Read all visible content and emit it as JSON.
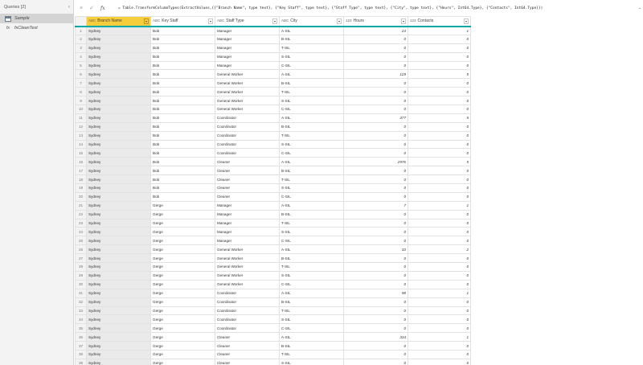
{
  "queries": {
    "header": "Queries [2]",
    "items": [
      {
        "label": "Sample",
        "icon": "table-icon",
        "selected": true
      },
      {
        "label": "fxCleanText",
        "icon": "function-icon",
        "selected": false
      }
    ]
  },
  "formula_bar": {
    "cancel": "×",
    "commit": "✓",
    "fx": "fx",
    "formula": "= Table.TransformColumnTypes(ExtractValues,{{\"Branch Name\", type text}, {\"Key Staff\", type text}, {\"Staff Type\", type text}, {\"City\", type text}, {\"Hours\", Int64.Type}, {\"Contacts\", Int64.Type}})",
    "expand": "⌄"
  },
  "columns": [
    {
      "label": "Branch Name",
      "type": "ABC"
    },
    {
      "label": "Key Staff",
      "type": "ABC"
    },
    {
      "label": "Staff Type",
      "type": "ABC"
    },
    {
      "label": "City",
      "type": "ABC"
    },
    {
      "label": "Hours",
      "type": "123"
    },
    {
      "label": "Contacts",
      "type": "123"
    }
  ],
  "rows": [
    [
      "Sydney",
      "Bob",
      "Manager",
      "A-SIL",
      "24",
      "1"
    ],
    [
      "Sydney",
      "Bob",
      "Manager",
      "B-SIL",
      "0",
      "0"
    ],
    [
      "Sydney",
      "Bob",
      "Manager",
      "T-SIL",
      "0",
      "0"
    ],
    [
      "Sydney",
      "Bob",
      "Manager",
      "S-SIL",
      "0",
      "0"
    ],
    [
      "Sydney",
      "Bob",
      "Manager",
      "C-SIL",
      "0",
      "0"
    ],
    [
      "Sydney",
      "Bob",
      "General Worker",
      "A-SIL",
      "129",
      "5"
    ],
    [
      "Sydney",
      "Bob",
      "General Worker",
      "B-SIL",
      "0",
      "0"
    ],
    [
      "Sydney",
      "Bob",
      "General Worker",
      "T-SIL",
      "0",
      "0"
    ],
    [
      "Sydney",
      "Bob",
      "General Worker",
      "S-SIL",
      "0",
      "0"
    ],
    [
      "Sydney",
      "Bob",
      "General Worker",
      "C-SIL",
      "0",
      "0"
    ],
    [
      "Sydney",
      "Bob",
      "Coordinator",
      "A-SIL",
      "477",
      "5"
    ],
    [
      "Sydney",
      "Bob",
      "Coordinator",
      "B-SIL",
      "0",
      "0"
    ],
    [
      "Sydney",
      "Bob",
      "Coordinator",
      "T-SIL",
      "0",
      "0"
    ],
    [
      "Sydney",
      "Bob",
      "Coordinator",
      "S-SIL",
      "0",
      "0"
    ],
    [
      "Sydney",
      "Bob",
      "Coordinator",
      "C-SIL",
      "0",
      "0"
    ],
    [
      "Sydney",
      "Bob",
      "Cleaner",
      "A-SIL",
      "2976",
      "5"
    ],
    [
      "Sydney",
      "Bob",
      "Cleaner",
      "B-SIL",
      "0",
      "0"
    ],
    [
      "Sydney",
      "Bob",
      "Cleaner",
      "T-SIL",
      "0",
      "0"
    ],
    [
      "Sydney",
      "Bob",
      "Cleaner",
      "S-SIL",
      "0",
      "0"
    ],
    [
      "Sydney",
      "Bob",
      "Cleaner",
      "C-SIL",
      "0",
      "0"
    ],
    [
      "Sydney",
      "Gerge",
      "Manager",
      "A-SIL",
      "7",
      "1"
    ],
    [
      "Sydney",
      "Gerge",
      "Manager",
      "B-SIL",
      "0",
      "0"
    ],
    [
      "Sydney",
      "Gerge",
      "Manager",
      "T-SIL",
      "0",
      "0"
    ],
    [
      "Sydney",
      "Gerge",
      "Manager",
      "S-SIL",
      "0",
      "0"
    ],
    [
      "Sydney",
      "Gerge",
      "Manager",
      "C-SIL",
      "0",
      "0"
    ],
    [
      "Sydney",
      "Gerge",
      "General Worker",
      "A-SIL",
      "33",
      "2"
    ],
    [
      "Sydney",
      "Gerge",
      "General Worker",
      "B-SIL",
      "0",
      "0"
    ],
    [
      "Sydney",
      "Gerge",
      "General Worker",
      "T-SIL",
      "0",
      "0"
    ],
    [
      "Sydney",
      "Gerge",
      "General Worker",
      "S-SIL",
      "0",
      "0"
    ],
    [
      "Sydney",
      "Gerge",
      "General Worker",
      "C-SIL",
      "0",
      "0"
    ],
    [
      "Sydney",
      "Gerge",
      "Coordinator",
      "A-SIL",
      "98",
      "1"
    ],
    [
      "Sydney",
      "Gerge",
      "Coordinator",
      "B-SIL",
      "0",
      "0"
    ],
    [
      "Sydney",
      "Gerge",
      "Coordinator",
      "T-SIL",
      "0",
      "0"
    ],
    [
      "Sydney",
      "Gerge",
      "Coordinator",
      "S-SIL",
      "0",
      "0"
    ],
    [
      "Sydney",
      "Gerge",
      "Coordinator",
      "C-SIL",
      "0",
      "0"
    ],
    [
      "Sydney",
      "Gerge",
      "Cleaner",
      "A-SIL",
      "334",
      "1"
    ],
    [
      "Sydney",
      "Gerge",
      "Cleaner",
      "B-SIL",
      "0",
      "0"
    ],
    [
      "Sydney",
      "Gerge",
      "Cleaner",
      "T-SIL",
      "0",
      "0"
    ],
    [
      "Sydney",
      "Gerge",
      "Cleaner",
      "S-SIL",
      "0",
      "0"
    ]
  ],
  "colors": {
    "selected_header": "#f6ce3c",
    "header_underline": "#00a9a5"
  }
}
